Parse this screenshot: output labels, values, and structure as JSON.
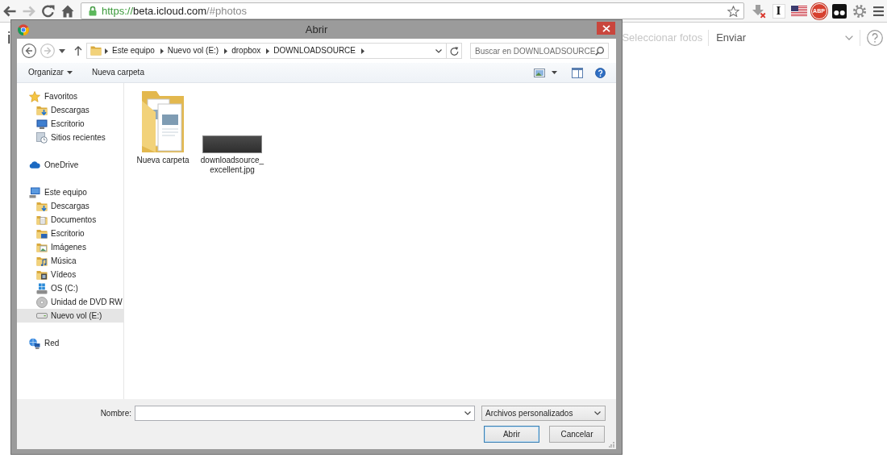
{
  "browser": {
    "nav_buttons": [
      {
        "kind": "back",
        "disabled": false
      },
      {
        "kind": "forward",
        "disabled": true
      },
      {
        "kind": "reload",
        "disabled": false
      },
      {
        "kind": "home",
        "disabled": false
      }
    ],
    "address": {
      "secure": true,
      "scheme": "https://",
      "host": "beta.icloud.com",
      "path": "/#photos"
    },
    "extensions": [
      {
        "kind": "download-blocked"
      },
      {
        "kind": "letter",
        "label": "I"
      },
      {
        "kind": "flag"
      },
      {
        "kind": "stop-sign",
        "label": "ABP"
      },
      {
        "kind": "dots-tile"
      },
      {
        "kind": "gear"
      }
    ]
  },
  "page": {
    "title_fragment": "i",
    "select_photos": {
      "label": "Seleccionar fotos",
      "disabled": true
    },
    "send": "Enviar"
  },
  "dialog": {
    "title": "Abrir",
    "nav": {
      "back_disabled": false,
      "forward_disabled": true
    },
    "breadcrumb": [
      "Este equipo",
      "Nuevo vol (E:)",
      "dropbox",
      "DOWNLOADSOURCE"
    ],
    "search": {
      "placeholder": "Buscar en DOWNLOADSOURCE"
    },
    "toolbar": [
      {
        "label": "Organizar",
        "dropdown": true
      },
      {
        "label": "Nueva carpeta",
        "dropdown": false
      }
    ],
    "sidebar": [
      {
        "label": "Favoritos",
        "kind": "favorites",
        "selected": false,
        "children": [
          {
            "label": "Descargas",
            "kind": "downloads",
            "selected": false
          },
          {
            "label": "Escritorio",
            "kind": "desktop",
            "selected": false
          },
          {
            "label": "Sitios recientes",
            "kind": "recent",
            "selected": false
          }
        ]
      },
      {
        "label": "OneDrive",
        "kind": "cloud",
        "selected": false
      },
      {
        "label": "Este equipo",
        "kind": "computer",
        "selected": false,
        "children": [
          {
            "label": "Descargas",
            "kind": "downloads",
            "selected": false
          },
          {
            "label": "Documentos",
            "kind": "documents",
            "selected": false
          },
          {
            "label": "Escritorio",
            "kind": "desktop-folder",
            "selected": false
          },
          {
            "label": "Imágenes",
            "kind": "pictures",
            "selected": false
          },
          {
            "label": "Música",
            "kind": "music",
            "selected": false
          },
          {
            "label": "Vídeos",
            "kind": "videos",
            "selected": false
          },
          {
            "label": "OS (C:)",
            "kind": "system-drive",
            "selected": false
          },
          {
            "label": "Unidad de DVD RW",
            "kind": "dvd",
            "selected": false
          },
          {
            "label": "Nuevo vol (E:)",
            "kind": "drive",
            "selected": true
          }
        ]
      },
      {
        "label": "Red",
        "kind": "network",
        "selected": false
      }
    ],
    "files": [
      {
        "kind": "folder",
        "name": "Nueva carpeta",
        "selected": false
      },
      {
        "kind": "image",
        "name": "downloadsource_excellent.jpg",
        "selected": false
      }
    ],
    "filename": {
      "label": "Nombre:"
    },
    "filter": {
      "value": "Archivos personalizados"
    },
    "buttons": [
      {
        "label": "Abrir",
        "default": true
      },
      {
        "label": "Cancelar",
        "default": false
      }
    ]
  }
}
